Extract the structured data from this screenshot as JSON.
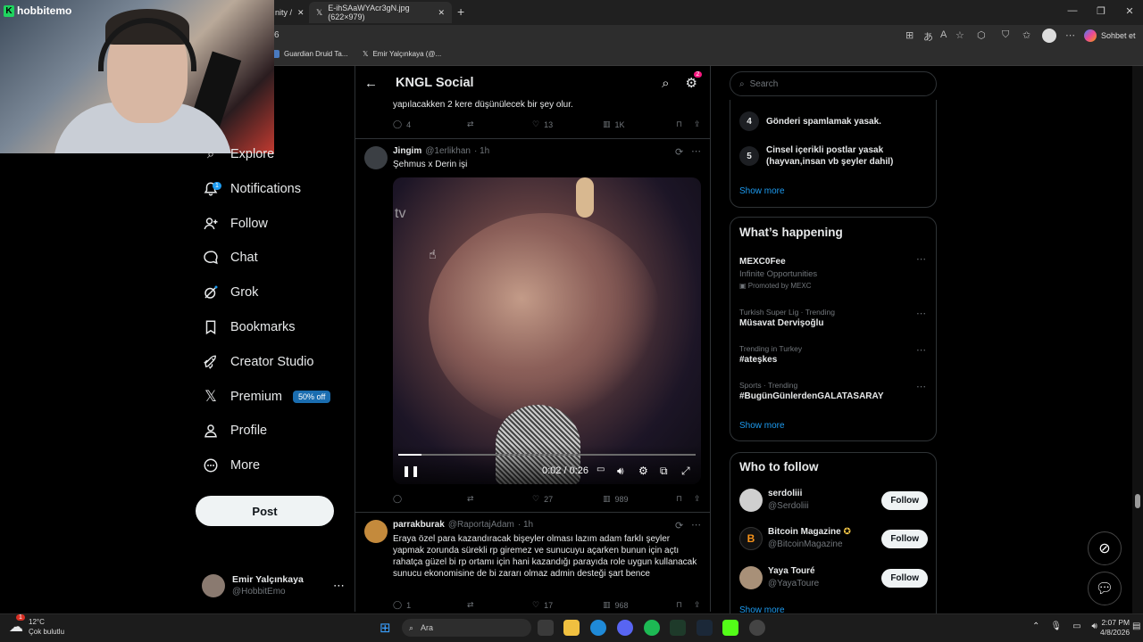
{
  "browser": {
    "tabs": [
      {
        "label": "nity /"
      },
      {
        "label": "E-ihSAaWYAcr3gN.jpg (622×979)"
      }
    ],
    "address_fragment": "6",
    "favorites": [
      {
        "label": "Guardian Druid Ta..."
      },
      {
        "label": "Emir Yalçınkaya (@..."
      }
    ],
    "copilot_label": "Sohbet et"
  },
  "webcam": {
    "brand": "hobbitemo"
  },
  "nav": {
    "items": [
      {
        "label": "Explore",
        "icon": "search-icon"
      },
      {
        "label": "Notifications",
        "icon": "bell-icon",
        "badge": "1"
      },
      {
        "label": "Follow",
        "icon": "person-add-icon"
      },
      {
        "label": "Chat",
        "icon": "chat-icon"
      },
      {
        "label": "Grok",
        "icon": "grok-icon"
      },
      {
        "label": "Bookmarks",
        "icon": "bookmark-icon"
      },
      {
        "label": "Creator Studio",
        "icon": "rocket-icon"
      },
      {
        "label": "Premium",
        "icon": "x-logo-icon",
        "pill": "50% off"
      },
      {
        "label": "Profile",
        "icon": "person-icon"
      },
      {
        "label": "More",
        "icon": "more-circle-icon"
      }
    ],
    "post_label": "Post",
    "account": {
      "name": "Emir Yalçınkaya",
      "handle": "@HobbitEmo"
    }
  },
  "feed": {
    "title": "KNGL Social",
    "settings_badge": "2",
    "posts": [
      {
        "text": "yapılacakken 2 kere düşünülecek bir şey olur.",
        "replies": "4",
        "reposts": "",
        "likes": "13",
        "views": "1K"
      },
      {
        "author": "Jingim",
        "handle": "@1erlikhan",
        "time": "· 1h",
        "text": "Şehmus x Derin işi",
        "video": {
          "time": "0:02 / 0:26",
          "watermark": "tv",
          "progress": 0.077
        },
        "replies": "",
        "reposts": "",
        "likes": "27",
        "views": "989"
      },
      {
        "author": "parrakburak",
        "handle": "@RaportajAdam",
        "time": "· 1h",
        "text": "Eraya özel para kazandıracak bişeyler olması lazım adam farklı şeyler yapmak zorunda sürekli rp giremez ve sunucuyu açarken bunun için açtı rahatça güzel bi rp ortamı için hani kazandığı parayıda role uygun kullanacak sunucu ekonomisine de bi zararı olmaz admin desteği şart bence",
        "replies": "1",
        "reposts": "",
        "likes": "17",
        "views": "968"
      }
    ]
  },
  "sidebar": {
    "search_placeholder": "Search",
    "rules": [
      {
        "num": "4",
        "text": "Gönderi spamlamak yasak."
      },
      {
        "num": "5",
        "text": "Cinsel içerikli postlar yasak (hayvan,insan vb şeyler dahil)"
      }
    ],
    "show_more": "Show more",
    "happening_title": "What’s happening",
    "trends": [
      {
        "context": "",
        "title": "MEXC0Fee",
        "sub": "Infinite Opportunities",
        "promo": "Promoted by MEXC"
      },
      {
        "context": "Turkish Super Lig · Trending",
        "title": "Müsavat Dervişoğlu"
      },
      {
        "context": "Trending in Turkey",
        "title": "#ateşkes"
      },
      {
        "context": "Sports · Trending",
        "title": "#BugünGünlerdenGALATASARAY"
      }
    ],
    "who_title": "Who to follow",
    "follow_label": "Follow",
    "who": [
      {
        "name": "serdoliii",
        "handle": "@Serdoliii",
        "color": "#cfcfcf"
      },
      {
        "name": "Bitcoin Magazine",
        "handle": "@BitcoinMagazine",
        "color": "#111111",
        "verified": true
      },
      {
        "name": "Yaya Touré",
        "handle": "@YayaToure",
        "color": "#a89078"
      }
    ],
    "who_more": "Show more"
  },
  "taskbar": {
    "weather_temp": "12°C",
    "weather_desc": "Çok bulutlu",
    "weather_badge": "1",
    "search_label": "Ara",
    "time": "2:07 PM",
    "date": "4/8/2026"
  }
}
